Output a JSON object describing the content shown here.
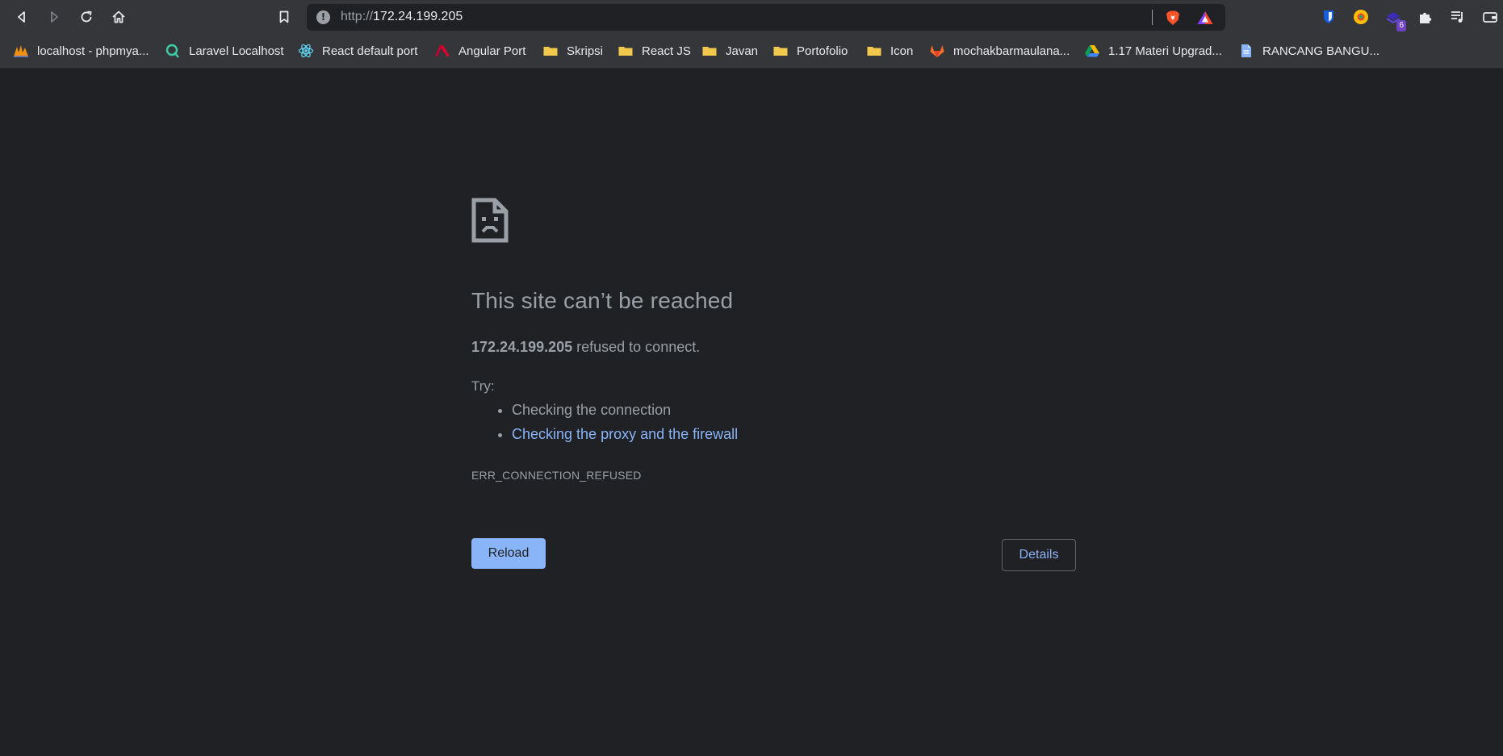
{
  "browser": {
    "url_scheme": "http://",
    "url_host": "172.24.199.205",
    "extension_badge": "6"
  },
  "bookmarks": [
    {
      "label": "localhost - phpmya...",
      "icon": "phpmyadmin-icon"
    },
    {
      "label": "Laravel Localhost",
      "icon": "laravel-icon"
    },
    {
      "label": "React default port",
      "icon": "react-icon"
    },
    {
      "label": "Angular Port",
      "icon": "angular-icon"
    },
    {
      "label": "Skripsi",
      "icon": "folder-icon"
    },
    {
      "label": "React JS",
      "icon": "folder-icon"
    },
    {
      "label": "Javan",
      "icon": "folder-icon"
    },
    {
      "label": "Portofolio",
      "icon": "folder-icon"
    },
    {
      "label": "Icon",
      "icon": "folder-icon"
    },
    {
      "label": "mochakbarmaulana...",
      "icon": "gitlab-icon"
    },
    {
      "label": "1.17 Materi Upgrad...",
      "icon": "google-drive-icon"
    },
    {
      "label": "RANCANG BANGU...",
      "icon": "document-icon"
    }
  ],
  "error": {
    "title": "This site can’t be reached",
    "host": "172.24.199.205",
    "message_suffix": " refused to connect.",
    "try_label": "Try:",
    "suggestions": [
      "Checking the connection",
      "Checking the proxy and the firewall"
    ],
    "code": "ERR_CONNECTION_REFUSED",
    "reload_label": "Reload",
    "details_label": "Details"
  },
  "colors": {
    "background": "#202124",
    "toolbar": "#35363a",
    "link": "#8ab4f8",
    "text": "#9aa0a6"
  }
}
